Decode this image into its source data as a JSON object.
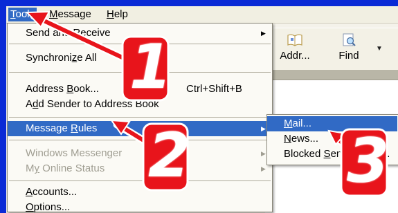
{
  "menubar": {
    "tools": {
      "pre": "",
      "u": "T",
      "post": "ools"
    },
    "message": {
      "pre": "",
      "u": "M",
      "post": "essage"
    },
    "help": {
      "pre": "",
      "u": "H",
      "post": "elp"
    }
  },
  "toolbar": {
    "address_label": "Addr...",
    "find_label": "Find"
  },
  "tools_menu": {
    "send_receive": {
      "pre": "Send and Receive",
      "u": "",
      "post": ""
    },
    "synchronize": {
      "pre": "Synchroni",
      "u": "z",
      "post": "e All"
    },
    "address_book": {
      "pre": "Address ",
      "u": "B",
      "post": "ook..."
    },
    "address_book_shortcut": "Ctrl+Shift+B",
    "add_sender": {
      "pre": "A",
      "u": "d",
      "post": "d Sender to Address Book"
    },
    "message_rules": {
      "pre": "Message ",
      "u": "R",
      "post": "ules"
    },
    "windows_messenger": "Windows Messenger",
    "online_status": {
      "pre": "M",
      "u": "y",
      "post": " Online Status"
    },
    "accounts": {
      "pre": "",
      "u": "A",
      "post": "ccounts..."
    },
    "options": {
      "pre": "",
      "u": "O",
      "post": "ptions..."
    }
  },
  "rules_submenu": {
    "mail": {
      "pre": "",
      "u": "M",
      "post": "ail..."
    },
    "news": {
      "pre": "",
      "u": "N",
      "post": "ews..."
    },
    "blocked": {
      "pre": "Blocked ",
      "u": "S",
      "post": "enders List..."
    }
  },
  "callouts": {
    "one": "1",
    "two": "2",
    "three": "3"
  },
  "colors": {
    "highlight": "#316ac5",
    "callout_red": "#e8141b",
    "frame_blue": "#0a2ad6"
  }
}
